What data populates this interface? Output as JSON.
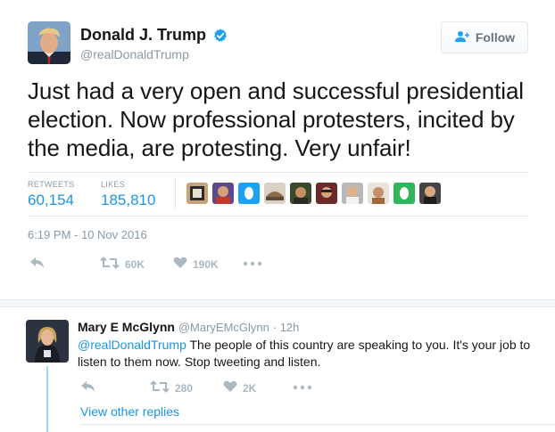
{
  "tweet": {
    "author_name": "Donald J. Trump",
    "author_handle": "@realDonaldTrump",
    "follow_label": "Follow",
    "text": "Just had a very open and successful presidential election. Now professional protesters, incited by the media, are protesting. Very unfair!",
    "stats": {
      "retweets_label": "RETWEETS",
      "retweets_value": "60,154",
      "likes_label": "LIKES",
      "likes_value": "185,810"
    },
    "timestamp": "6:19 PM - 10 Nov 2016",
    "actions": {
      "retweet_count": "60K",
      "like_count": "190K"
    }
  },
  "reply": {
    "author_name": "Mary E McGlynn",
    "author_handle": "@MaryEMcGlynn",
    "time": "· 12h",
    "mention": "@realDonaldTrump",
    "text": "  The people of this country are speaking to you. It's your job to listen to them now.  Stop tweeting and listen.",
    "actions": {
      "retweet_count": "280",
      "like_count": "2K"
    },
    "view_other_replies": "View other replies"
  },
  "colors": {
    "accent": "#1b95e0",
    "muted": "#8899a6",
    "action_gray": "#aab8c2",
    "thread_line": "#a4d9f5"
  },
  "icons": {
    "verified": "verified-badge-icon",
    "follow": "add-user-icon",
    "reply": "reply-arrow-icon",
    "retweet": "retweet-icon",
    "like": "heart-icon",
    "more": "more-dots-icon"
  }
}
